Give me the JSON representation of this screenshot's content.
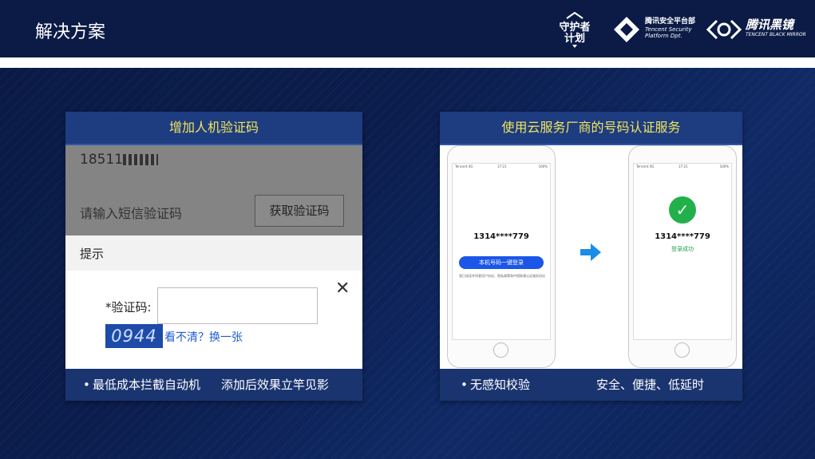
{
  "header": {
    "title": "解决方案",
    "logos": [
      {
        "name": "guardian-plan-logo",
        "text": "守护者 计划"
      },
      {
        "name": "tencent-security-logo",
        "text": "腾讯安全平台部",
        "sub": "Tencent Security Platform Dpt."
      },
      {
        "name": "tencent-black-mirror-logo",
        "text": "腾讯黑镜",
        "sub": "TENCENT BLACK MIRROR"
      }
    ]
  },
  "left_panel": {
    "title": "增加人机验证码",
    "phone_number": "18511",
    "sms_placeholder": "请输入短信验证码",
    "sms_button": "获取验证码",
    "tip_label": "提示",
    "close_icon": "close-icon",
    "code_label": "*验证码:",
    "captcha_text": "0944",
    "refresh_link": "看不清？换一张",
    "footer_items": [
      "最低成本拦截自动机",
      "添加后效果立竿见影"
    ]
  },
  "right_panel": {
    "title": "使用云服务厂商的号码认证服务",
    "phone_left": {
      "status_left": "Tencent 4G",
      "status_time": "17:21",
      "status_battery": "100%",
      "number": "1314****779",
      "button": "本机号码一键登录",
      "agreement": "我已阅读并同意用户协议、隐私政策和中国联通认证服务协议"
    },
    "phone_right": {
      "status_left": "Tencent 4G",
      "status_time": "17:21",
      "status_battery": "100%",
      "number": "1314****779",
      "success_text": "登录成功"
    },
    "footer_items": [
      "无感知校验",
      "安全、便捷、低延时"
    ]
  },
  "colors": {
    "background": "#0b1d4d",
    "panel_title": "#f3e65a",
    "login_button": "#1b56e8",
    "success_green": "#22b04a",
    "arrow_blue": "#1a8de8"
  }
}
